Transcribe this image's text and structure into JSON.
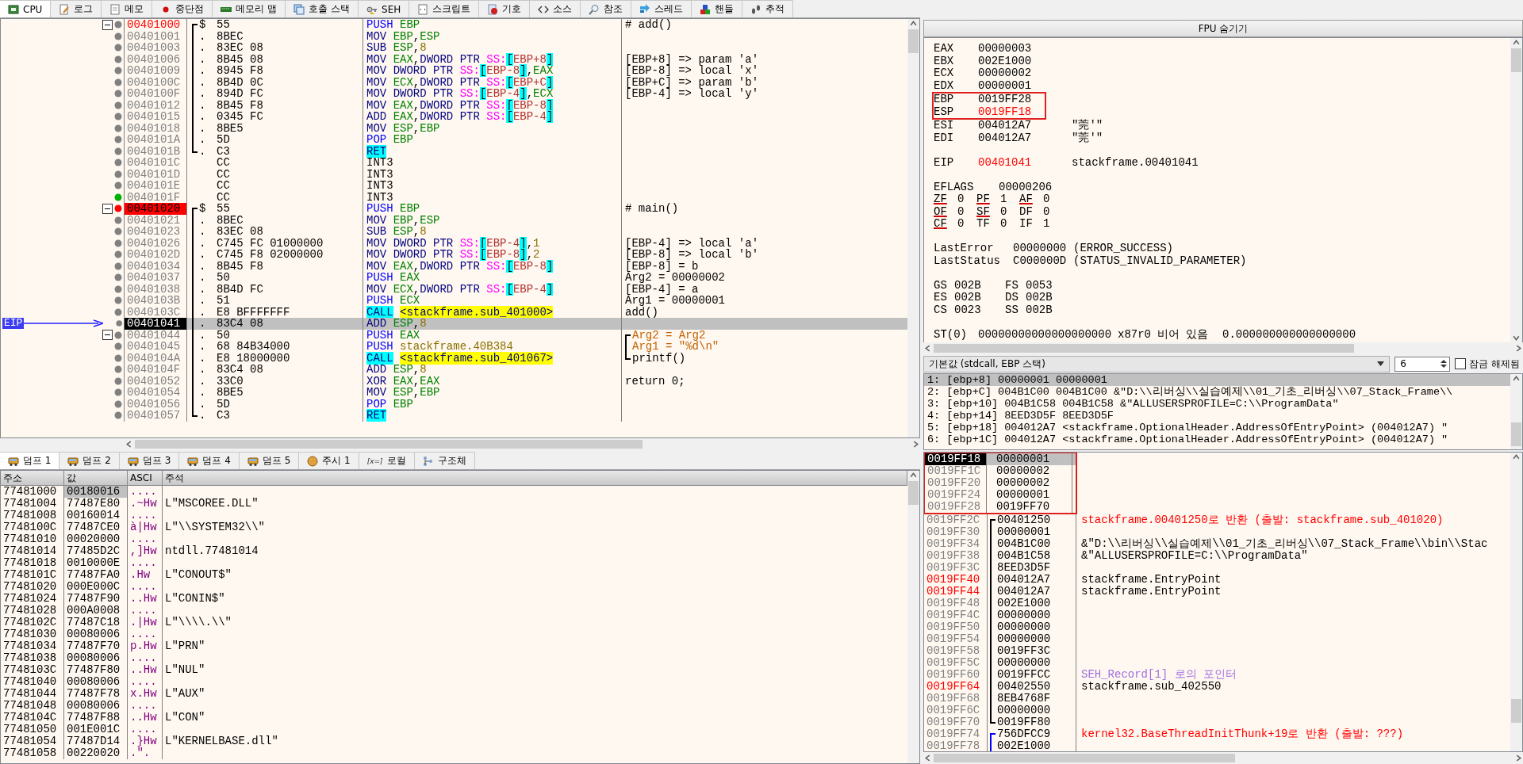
{
  "main_tabs": [
    {
      "label": "CPU",
      "selected": true
    },
    {
      "label": "로그",
      "selected": false
    },
    {
      "label": "메모",
      "selected": false
    },
    {
      "label": "중단점",
      "selected": false
    },
    {
      "label": "메모리 맵",
      "selected": false
    },
    {
      "label": "호출 스택",
      "selected": false
    },
    {
      "label": "SEH",
      "selected": false
    },
    {
      "label": "스크립트",
      "selected": false
    },
    {
      "label": "기호",
      "selected": false
    },
    {
      "label": "소스",
      "selected": false
    },
    {
      "label": "참조",
      "selected": false
    },
    {
      "label": "스레드",
      "selected": false
    },
    {
      "label": "핸들",
      "selected": false
    },
    {
      "label": "추적",
      "selected": false
    }
  ],
  "disassembly": {
    "eip_label": "EIP",
    "rows": [
      {
        "address": "00401000",
        "kind": "function",
        "color": "#808080",
        "collapse": true,
        "bracket": {
          "kind": "start"
        },
        "marker": "$",
        "bytes": "55",
        "mnemonic": {
          "text": "PUSH",
          "kind": "stack"
        },
        "ops": [
          {
            "text": "EBP",
            "kind": "reg"
          }
        ],
        "comment": {
          "text": "# add()",
          "kind": "plain"
        },
        "selected": false
      },
      {
        "address": "00401001",
        "kind": "plain",
        "color": "#808080",
        "collapse": false,
        "bracket": {
          "kind": "mid"
        },
        "marker": ".",
        "bytes": "8BEC",
        "mnemonic": {
          "text": "MOV",
          "kind": "op"
        },
        "ops": [
          {
            "text": "EBP",
            "kind": "reg"
          },
          {
            "text": ",",
            "kind": "sep"
          },
          {
            "text": "ESP",
            "kind": "reg"
          }
        ],
        "selected": false
      },
      {
        "address": "00401003",
        "kind": "plain",
        "color": "#808080",
        "collapse": false,
        "bracket": {
          "kind": "mid"
        },
        "marker": ".",
        "bytes": "83EC 08",
        "mnemonic": {
          "text": "SUB",
          "kind": "op"
        },
        "ops": [
          {
            "text": "ESP",
            "kind": "reg"
          },
          {
            "text": ",",
            "kind": "sep"
          },
          {
            "text": "8",
            "kind": "num"
          }
        ],
        "selected": false
      },
      {
        "address": "00401006",
        "kind": "plain",
        "color": "#808080",
        "collapse": false,
        "bracket": {
          "kind": "mid"
        },
        "marker": ".",
        "bytes": "8B45 08",
        "mnemonic": {
          "text": "MOV",
          "kind": "op"
        },
        "ops": [
          {
            "text": "EAX",
            "kind": "reg"
          },
          {
            "text": ",",
            "kind": "sep"
          },
          {
            "text": "DWORD PTR ",
            "kind": "size"
          },
          {
            "text": "SS:",
            "kind": "seg"
          },
          {
            "text": "[",
            "kind": "brk"
          },
          {
            "text": "EBP+8",
            "kind": "mem"
          },
          {
            "text": "]",
            "kind": "brk"
          }
        ],
        "comment": {
          "text": "[EBP+8] => param 'a'",
          "kind": "plain"
        },
        "selected": false
      },
      {
        "address": "00401009",
        "kind": "plain",
        "color": "#808080",
        "collapse": false,
        "bracket": {
          "kind": "mid"
        },
        "marker": ".",
        "bytes": "8945 F8",
        "mnemonic": {
          "text": "MOV",
          "kind": "op"
        },
        "ops": [
          {
            "text": "DWORD PTR ",
            "kind": "size"
          },
          {
            "text": "SS:",
            "kind": "seg"
          },
          {
            "text": "[",
            "kind": "brk"
          },
          {
            "text": "EBP-8",
            "kind": "mem"
          },
          {
            "text": "]",
            "kind": "brk"
          },
          {
            "text": ",",
            "kind": "sep"
          },
          {
            "text": "EAX",
            "kind": "reg"
          }
        ],
        "comment": {
          "text": "[EBP-8] => local 'x'",
          "kind": "plain"
        },
        "selected": false
      },
      {
        "address": "0040100C",
        "kind": "plain",
        "color": "#808080",
        "collapse": false,
        "bracket": {
          "kind": "mid"
        },
        "marker": ".",
        "bytes": "8B4D 0C",
        "mnemonic": {
          "text": "MOV",
          "kind": "op"
        },
        "ops": [
          {
            "text": "ECX",
            "kind": "reg"
          },
          {
            "text": ",",
            "kind": "sep"
          },
          {
            "text": "DWORD PTR ",
            "kind": "size"
          },
          {
            "text": "SS:",
            "kind": "seg"
          },
          {
            "text": "[",
            "kind": "brk"
          },
          {
            "text": "EBP+C",
            "kind": "mem"
          },
          {
            "text": "]",
            "kind": "brk"
          }
        ],
        "comment": {
          "text": "[EBP+C] => param 'b'",
          "kind": "plain"
        },
        "selected": false
      },
      {
        "address": "0040100F",
        "kind": "plain",
        "color": "#808080",
        "collapse": false,
        "bracket": {
          "kind": "mid"
        },
        "marker": ".",
        "bytes": "894D FC",
        "mnemonic": {
          "text": "MOV",
          "kind": "op"
        },
        "ops": [
          {
            "text": "DWORD PTR ",
            "kind": "size"
          },
          {
            "text": "SS:",
            "kind": "seg"
          },
          {
            "text": "[",
            "kind": "brk"
          },
          {
            "text": "EBP-4",
            "kind": "mem"
          },
          {
            "text": "]",
            "kind": "brk"
          },
          {
            "text": ",",
            "kind": "sep"
          },
          {
            "text": "ECX",
            "kind": "reg"
          }
        ],
        "comment": {
          "text": "[EBP-4] => local 'y'",
          "kind": "plain"
        },
        "selected": false
      },
      {
        "address": "00401012",
        "kind": "plain",
        "color": "#808080",
        "collapse": false,
        "bracket": {
          "kind": "mid"
        },
        "marker": ".",
        "bytes": "8B45 F8",
        "mnemonic": {
          "text": "MOV",
          "kind": "op"
        },
        "ops": [
          {
            "text": "EAX",
            "kind": "reg"
          },
          {
            "text": ",",
            "kind": "sep"
          },
          {
            "text": "DWORD PTR ",
            "kind": "size"
          },
          {
            "text": "SS:",
            "kind": "seg"
          },
          {
            "text": "[",
            "kind": "brk"
          },
          {
            "text": "EBP-8",
            "kind": "mem"
          },
          {
            "text": "]",
            "kind": "brk"
          }
        ],
        "selected": false
      },
      {
        "address": "00401015",
        "kind": "plain",
        "color": "#808080",
        "collapse": false,
        "bracket": {
          "kind": "mid"
        },
        "marker": ".",
        "bytes": "0345 FC",
        "mnemonic": {
          "text": "ADD",
          "kind": "op"
        },
        "ops": [
          {
            "text": "EAX",
            "kind": "reg"
          },
          {
            "text": ",",
            "kind": "sep"
          },
          {
            "text": "DWORD PTR ",
            "kind": "size"
          },
          {
            "text": "SS:",
            "kind": "seg"
          },
          {
            "text": "[",
            "kind": "brk"
          },
          {
            "text": "EBP-4",
            "kind": "mem"
          },
          {
            "text": "]",
            "kind": "brk"
          }
        ],
        "selected": false
      },
      {
        "address": "00401018",
        "kind": "plain",
        "color": "#808080",
        "collapse": false,
        "bracket": {
          "kind": "mid"
        },
        "marker": ".",
        "bytes": "8BE5",
        "mnemonic": {
          "text": "MOV",
          "kind": "op"
        },
        "ops": [
          {
            "text": "ESP",
            "kind": "reg"
          },
          {
            "text": ",",
            "kind": "sep"
          },
          {
            "text": "EBP",
            "kind": "reg"
          }
        ],
        "selected": false
      },
      {
        "address": "0040101A",
        "kind": "plain",
        "color": "#808080",
        "collapse": false,
        "bracket": {
          "kind": "mid"
        },
        "marker": ".",
        "bytes": "5D",
        "mnemonic": {
          "text": "POP",
          "kind": "stack"
        },
        "ops": [
          {
            "text": "EBP",
            "kind": "reg"
          }
        ],
        "selected": false
      },
      {
        "address": "0040101B",
        "kind": "plain",
        "color": "#808080",
        "collapse": false,
        "bracket": {
          "kind": "end"
        },
        "marker": ".",
        "bytes": "C3",
        "mnemonic": {
          "text": "RET",
          "kind": "branch"
        },
        "ops": [],
        "selected": false
      },
      {
        "address": "0040101C",
        "kind": "plain",
        "color": "#808080",
        "collapse": false,
        "bracket": {
          "kind": "none"
        },
        "bytes": "CC",
        "mnemonic": {
          "text": "INT3",
          "kind": "int"
        },
        "ops": [],
        "selected": false
      },
      {
        "address": "0040101D",
        "kind": "plain",
        "color": "#808080",
        "collapse": false,
        "bracket": {
          "kind": "none"
        },
        "bytes": "CC",
        "mnemonic": {
          "text": "INT3",
          "kind": "int"
        },
        "ops": [],
        "selected": false
      },
      {
        "address": "0040101E",
        "kind": "plain",
        "color": "#808080",
        "collapse": false,
        "bracket": {
          "kind": "none"
        },
        "bytes": "CC",
        "mnemonic": {
          "text": "INT3",
          "kind": "int"
        },
        "ops": [],
        "selected": false
      },
      {
        "address": "0040101F",
        "kind": "plain",
        "color": "#00b000",
        "collapse": false,
        "bracket": {
          "kind": "none"
        },
        "bytes": "CC",
        "mnemonic": {
          "text": "INT3",
          "kind": "int"
        },
        "ops": [],
        "selected": false
      },
      {
        "address": "00401020",
        "kind": "breakpoint",
        "color": "#ff0000",
        "collapse": true,
        "bracket": {
          "kind": "start"
        },
        "marker": "$",
        "bytes": "55",
        "mnemonic": {
          "text": "PUSH",
          "kind": "stack"
        },
        "ops": [
          {
            "text": "EBP",
            "kind": "reg"
          }
        ],
        "comment": {
          "text": "# main()",
          "kind": "plain"
        },
        "selected": false
      },
      {
        "address": "00401021",
        "kind": "plain",
        "color": "#808080",
        "collapse": false,
        "bracket": {
          "kind": "mid"
        },
        "marker": ".",
        "bytes": "8BEC",
        "mnemonic": {
          "text": "MOV",
          "kind": "op"
        },
        "ops": [
          {
            "text": "EBP",
            "kind": "reg"
          },
          {
            "text": ",",
            "kind": "sep"
          },
          {
            "text": "ESP",
            "kind": "reg"
          }
        ],
        "selected": false
      },
      {
        "address": "00401023",
        "kind": "plain",
        "color": "#808080",
        "collapse": false,
        "bracket": {
          "kind": "mid"
        },
        "marker": ".",
        "bytes": "83EC 08",
        "mnemonic": {
          "text": "SUB",
          "kind": "op"
        },
        "ops": [
          {
            "text": "ESP",
            "kind": "reg"
          },
          {
            "text": ",",
            "kind": "sep"
          },
          {
            "text": "8",
            "kind": "num"
          }
        ],
        "selected": false
      },
      {
        "address": "00401026",
        "kind": "plain",
        "color": "#808080",
        "collapse": false,
        "bracket": {
          "kind": "mid"
        },
        "marker": ".",
        "bytes": "C745 FC 01000000",
        "mnemonic": {
          "text": "MOV",
          "kind": "op"
        },
        "ops": [
          {
            "text": "DWORD PTR ",
            "kind": "size"
          },
          {
            "text": "SS:",
            "kind": "seg"
          },
          {
            "text": "[",
            "kind": "brk"
          },
          {
            "text": "EBP-4",
            "kind": "mem"
          },
          {
            "text": "]",
            "kind": "brk"
          },
          {
            "text": ",",
            "kind": "sep"
          },
          {
            "text": "1",
            "kind": "num"
          }
        ],
        "comment": {
          "text": "[EBP-4] => local 'a'",
          "kind": "plain"
        },
        "selected": false
      },
      {
        "address": "0040102D",
        "kind": "plain",
        "color": "#808080",
        "collapse": false,
        "bracket": {
          "kind": "mid"
        },
        "marker": ".",
        "bytes": "C745 F8 02000000",
        "mnemonic": {
          "text": "MOV",
          "kind": "op"
        },
        "ops": [
          {
            "text": "DWORD PTR ",
            "kind": "size"
          },
          {
            "text": "SS:",
            "kind": "seg"
          },
          {
            "text": "[",
            "kind": "brk"
          },
          {
            "text": "EBP-8",
            "kind": "mem"
          },
          {
            "text": "]",
            "kind": "brk"
          },
          {
            "text": ",",
            "kind": "sep"
          },
          {
            "text": "2",
            "kind": "num"
          }
        ],
        "comment": {
          "text": "[EBP-8] => local 'b'",
          "kind": "plain"
        },
        "selected": false
      },
      {
        "address": "00401034",
        "kind": "plain",
        "color": "#808080",
        "collapse": false,
        "bracket": {
          "kind": "mid"
        },
        "marker": ".",
        "bytes": "8B45 F8",
        "mnemonic": {
          "text": "MOV",
          "kind": "op"
        },
        "ops": [
          {
            "text": "EAX",
            "kind": "reg"
          },
          {
            "text": ",",
            "kind": "sep"
          },
          {
            "text": "DWORD PTR ",
            "kind": "size"
          },
          {
            "text": "SS:",
            "kind": "seg"
          },
          {
            "text": "[",
            "kind": "brk"
          },
          {
            "text": "EBP-8",
            "kind": "mem"
          },
          {
            "text": "]",
            "kind": "brk"
          }
        ],
        "comment": {
          "text": "[EBP-8] = b",
          "kind": "plain"
        },
        "selected": false
      },
      {
        "address": "00401037",
        "kind": "plain",
        "color": "#808080",
        "collapse": false,
        "bracket": {
          "kind": "mid"
        },
        "marker": ".",
        "bytes": "50",
        "mnemonic": {
          "text": "PUSH",
          "kind": "stack"
        },
        "ops": [
          {
            "text": "EAX",
            "kind": "reg"
          }
        ],
        "comment": {
          "text": "Arg2 = 00000002",
          "kind": "plain"
        },
        "selected": false
      },
      {
        "address": "00401038",
        "kind": "plain",
        "color": "#808080",
        "collapse": false,
        "bracket": {
          "kind": "mid"
        },
        "marker": ".",
        "bytes": "8B4D FC",
        "mnemonic": {
          "text": "MOV",
          "kind": "op"
        },
        "ops": [
          {
            "text": "ECX",
            "kind": "reg"
          },
          {
            "text": ",",
            "kind": "sep"
          },
          {
            "text": "DWORD PTR ",
            "kind": "size"
          },
          {
            "text": "SS:",
            "kind": "seg"
          },
          {
            "text": "[",
            "kind": "brk"
          },
          {
            "text": "EBP-4",
            "kind": "mem"
          },
          {
            "text": "]",
            "kind": "brk"
          }
        ],
        "comment": {
          "text": "[EBP-4] = a",
          "kind": "plain"
        },
        "selected": false
      },
      {
        "address": "0040103B",
        "kind": "plain",
        "color": "#808080",
        "collapse": false,
        "bracket": {
          "kind": "mid"
        },
        "marker": ".",
        "bytes": "51",
        "mnemonic": {
          "text": "PUSH",
          "kind": "stack"
        },
        "ops": [
          {
            "text": "ECX",
            "kind": "reg"
          }
        ],
        "comment": {
          "text": "Arg1 = 00000001",
          "kind": "plain"
        },
        "selected": false
      },
      {
        "address": "0040103C",
        "kind": "plain",
        "color": "#808080",
        "collapse": false,
        "bracket": {
          "kind": "mid"
        },
        "marker": ".",
        "bytes": "E8 BFFFFFFF",
        "mnemonic": {
          "text": "CALL",
          "kind": "branch"
        },
        "ops": [
          {
            "text": "<stackframe.sub_401000>",
            "kind": "label"
          }
        ],
        "comment": {
          "text": "add()",
          "kind": "plain"
        },
        "selected": false
      },
      {
        "address": "00401041",
        "kind": "plain",
        "color": "#808080",
        "collapse": false,
        "bracket": {
          "kind": "mid"
        },
        "marker": ".",
        "bytes": "83C4 08",
        "mnemonic": {
          "text": "ADD",
          "kind": "op"
        },
        "ops": [
          {
            "text": "ESP",
            "kind": "reg"
          },
          {
            "text": ",",
            "kind": "sep"
          },
          {
            "text": "8",
            "kind": "num"
          }
        ],
        "selected": true
      },
      {
        "address": "00401044",
        "kind": "plain",
        "color": "#808080",
        "collapse": true,
        "bracket": {
          "kind": "mid"
        },
        "marker": ".",
        "bytes": "50",
        "mnemonic": {
          "text": "PUSH",
          "kind": "stack"
        },
        "ops": [
          {
            "text": "EAX",
            "kind": "reg"
          }
        ],
        "comment": {
          "text": "Arg2 = Arg2",
          "kind": "arg",
          "bracket": {
            "kind": "start"
          }
        },
        "selected": false
      },
      {
        "address": "00401045",
        "kind": "plain",
        "color": "#808080",
        "collapse": false,
        "bracket": {
          "kind": "mid"
        },
        "marker": ".",
        "bytes": "68 84B34000",
        "mnemonic": {
          "text": "PUSH",
          "kind": "stack"
        },
        "ops": [
          {
            "text": "stackframe.40B384",
            "kind": "num"
          }
        ],
        "comment": {
          "text": "Arg1 = \"%d\\n\"",
          "kind": "arg",
          "bracket": {
            "kind": "mid"
          }
        },
        "selected": false
      },
      {
        "address": "0040104A",
        "kind": "plain",
        "color": "#808080",
        "collapse": false,
        "bracket": {
          "kind": "mid"
        },
        "marker": ".",
        "bytes": "E8 18000000",
        "mnemonic": {
          "text": "CALL",
          "kind": "branch"
        },
        "ops": [
          {
            "text": "<stackframe.sub_401067>",
            "kind": "label"
          }
        ],
        "comment": {
          "text": "printf()",
          "kind": "plain",
          "bracket": {
            "kind": "end"
          }
        },
        "selected": false
      },
      {
        "address": "0040104F",
        "kind": "plain",
        "color": "#808080",
        "collapse": false,
        "bracket": {
          "kind": "mid"
        },
        "marker": ".",
        "bytes": "83C4 08",
        "mnemonic": {
          "text": "ADD",
          "kind": "op"
        },
        "ops": [
          {
            "text": "ESP",
            "kind": "reg"
          },
          {
            "text": ",",
            "kind": "sep"
          },
          {
            "text": "8",
            "kind": "num"
          }
        ],
        "selected": false
      },
      {
        "address": "00401052",
        "kind": "plain",
        "color": "#808080",
        "collapse": false,
        "bracket": {
          "kind": "mid"
        },
        "marker": ".",
        "bytes": "33C0",
        "mnemonic": {
          "text": "XOR",
          "kind": "op"
        },
        "ops": [
          {
            "text": "EAX",
            "kind": "reg"
          },
          {
            "text": ",",
            "kind": "sep"
          },
          {
            "text": "EAX",
            "kind": "reg"
          }
        ],
        "comment": {
          "text": "return 0;",
          "kind": "plain"
        },
        "selected": false
      },
      {
        "address": "00401054",
        "kind": "plain",
        "color": "#808080",
        "collapse": false,
        "bracket": {
          "kind": "mid"
        },
        "marker": ".",
        "bytes": "8BE5",
        "mnemonic": {
          "text": "MOV",
          "kind": "op"
        },
        "ops": [
          {
            "text": "ESP",
            "kind": "reg"
          },
          {
            "text": ",",
            "kind": "sep"
          },
          {
            "text": "EBP",
            "kind": "reg"
          }
        ],
        "selected": false
      },
      {
        "address": "00401056",
        "kind": "plain",
        "color": "#808080",
        "collapse": false,
        "bracket": {
          "kind": "mid"
        },
        "marker": ".",
        "bytes": "5D",
        "mnemonic": {
          "text": "POP",
          "kind": "stack"
        },
        "ops": [
          {
            "text": "EBP",
            "kind": "reg"
          }
        ],
        "selected": false
      },
      {
        "address": "00401057",
        "kind": "plain",
        "color": "#808080",
        "collapse": false,
        "bracket": {
          "kind": "end"
        },
        "marker": ".",
        "bytes": "C3",
        "mnemonic": {
          "text": "RET",
          "kind": "branch"
        },
        "ops": [],
        "selected": false
      }
    ]
  },
  "registers": {
    "toggle_button": "FPU 숨기기",
    "general": [
      {
        "name": "EAX",
        "value": "00000003",
        "changed": false,
        "boxed": false
      },
      {
        "name": "EBX",
        "value": "002E1000",
        "changed": false,
        "boxed": false
      },
      {
        "name": "ECX",
        "value": "00000002",
        "changed": false,
        "boxed": false
      },
      {
        "name": "EDX",
        "value": "00000001",
        "changed": false,
        "boxed": false
      },
      {
        "name": "EBP",
        "value": "0019FF28",
        "changed": false,
        "boxed": true
      },
      {
        "name": "ESP",
        "value": "0019FF18",
        "changed": true,
        "boxed": true
      },
      {
        "name": "ESI",
        "value": "004012A7",
        "note": "\"莞'\"",
        "changed": false,
        "boxed": false
      },
      {
        "name": "EDI",
        "value": "004012A7",
        "note": "\"莞'\"",
        "changed": false,
        "boxed": false
      }
    ],
    "eip": {
      "name": "EIP",
      "value": "00401041",
      "note": "stackframe.00401041",
      "changed": true
    },
    "eflags": {
      "name": "EFLAGS",
      "value": "00000206"
    },
    "flags": [
      [
        {
          "name": "ZF",
          "value": "0",
          "underlined": true
        },
        {
          "name": "PF",
          "value": "1",
          "underlined": true
        },
        {
          "name": "AF",
          "value": "0",
          "underlined": true
        }
      ],
      [
        {
          "name": "OF",
          "value": "0",
          "underlined": true
        },
        {
          "name": "SF",
          "value": "0",
          "underlined": true
        },
        {
          "name": "DF",
          "value": "0",
          "underlined": false
        }
      ],
      [
        {
          "name": "CF",
          "value": "0",
          "underlined": true
        },
        {
          "name": "TF",
          "value": "0",
          "underlined": false
        },
        {
          "name": "IF",
          "value": "1",
          "underlined": false
        }
      ]
    ],
    "status": [
      {
        "name": "LastError",
        "value": "00000000",
        "note": "(ERROR_SUCCESS)"
      },
      {
        "name": "LastStatus",
        "value": "C000000D",
        "note": "(STATUS_INVALID_PARAMETER)"
      }
    ],
    "segments": [
      [
        {
          "name": "GS",
          "value": "002B"
        },
        {
          "name": "FS",
          "value": "0053"
        }
      ],
      [
        {
          "name": "ES",
          "value": "002B"
        },
        {
          "name": "DS",
          "value": "002B"
        }
      ],
      [
        {
          "name": "CS",
          "value": "0023"
        },
        {
          "name": "SS",
          "value": "002B"
        }
      ]
    ],
    "fpu": {
      "name": "ST(0)",
      "value": "00000000000000000000",
      "tag": "x87r0",
      "state": "비어 있음",
      "float": "0.000000000000000000"
    }
  },
  "call_args": {
    "convention": "기본값 (stdcall, EBP 스택)",
    "count": "6",
    "lock_label": "잠금 해제됨",
    "checked": false,
    "rows": [
      {
        "text": "1: [ebp+8] 00000001 00000001",
        "selected": true
      },
      {
        "text": "2: [ebp+C] 004B1C00 004B1C00 &\"D:\\\\리버싱\\\\실습예제\\\\01_기초_리버싱\\\\07_Stack_Frame\\\\",
        "selected": false
      },
      {
        "text": "3: [ebp+10] 004B1C58 004B1C58 &\"ALLUSERSPROFILE=C:\\\\ProgramData\"",
        "selected": false
      },
      {
        "text": "4: [ebp+14] 8EED3D5F 8EED3D5F",
        "selected": false
      },
      {
        "text": "5: [ebp+18] 004012A7 <stackframe.OptionalHeader.AddressOfEntryPoint> (004012A7) \"",
        "selected": false
      },
      {
        "text": "6: [ebp+1C] 004012A7 <stackframe.OptionalHeader.AddressOfEntryPoint> (004012A7) \"",
        "selected": false
      }
    ]
  },
  "dump_tabs": [
    {
      "label": "덤프 1",
      "selected": true
    },
    {
      "label": "덤프 2",
      "selected": false
    },
    {
      "label": "덤프 3",
      "selected": false
    },
    {
      "label": "덤프 4",
      "selected": false
    },
    {
      "label": "덤프 5",
      "selected": false
    },
    {
      "label": "주시 1",
      "selected": false
    },
    {
      "label": "로컬",
      "badge": "[x=]",
      "selected": false
    },
    {
      "label": "구조체",
      "selected": false
    }
  ],
  "dump": {
    "columns": [
      "주소",
      "값",
      "ASCI",
      "주석"
    ],
    "rows": [
      {
        "address": "77481000",
        "value": "00180016",
        "ascii": "....",
        "selected": true
      },
      {
        "address": "77481004",
        "value": "77487E80",
        "ascii": ".~Hw",
        "comment": "L\"MSCOREE.DLL\"",
        "selected": false
      },
      {
        "address": "77481008",
        "value": "00160014",
        "ascii": "....",
        "selected": false
      },
      {
        "address": "7748100C",
        "value": "77487CE0",
        "ascii": "à|Hw",
        "comment": "L\"\\\\SYSTEM32\\\\\"",
        "selected": false
      },
      {
        "address": "77481010",
        "value": "00020000",
        "ascii": "....",
        "selected": false
      },
      {
        "address": "77481014",
        "value": "77485D2C",
        "ascii": ",]Hw",
        "comment": "ntdll.77481014",
        "selected": false
      },
      {
        "address": "77481018",
        "value": "0010000E",
        "ascii": "....",
        "selected": false
      },
      {
        "address": "7748101C",
        "value": "77487FA0",
        "ascii": ".Hw",
        "comment": "L\"CONOUT$\"",
        "selected": false
      },
      {
        "address": "77481020",
        "value": "000E000C",
        "ascii": "....",
        "selected": false
      },
      {
        "address": "77481024",
        "value": "77487F90",
        "ascii": "..Hw",
        "comment": "L\"CONIN$\"",
        "selected": false
      },
      {
        "address": "77481028",
        "value": "000A0008",
        "ascii": "....",
        "selected": false
      },
      {
        "address": "7748102C",
        "value": "77487C18",
        "ascii": ".|Hw",
        "comment": "L\"\\\\\\\\.\\\\\"",
        "selected": false
      },
      {
        "address": "77481030",
        "value": "00080006",
        "ascii": "....",
        "selected": false
      },
      {
        "address": "77481034",
        "value": "77487F70",
        "ascii": "p.Hw",
        "comment": "L\"PRN\"",
        "selected": false
      },
      {
        "address": "77481038",
        "value": "00080006",
        "ascii": "....",
        "selected": false
      },
      {
        "address": "7748103C",
        "value": "77487F80",
        "ascii": "..Hw",
        "comment": "L\"NUL\"",
        "selected": false
      },
      {
        "address": "77481040",
        "value": "00080006",
        "ascii": "....",
        "selected": false
      },
      {
        "address": "77481044",
        "value": "77487F78",
        "ascii": "x.Hw",
        "comment": "L\"AUX\"",
        "selected": false
      },
      {
        "address": "77481048",
        "value": "00080006",
        "ascii": "....",
        "selected": false
      },
      {
        "address": "7748104C",
        "value": "77487F88",
        "ascii": "..Hw",
        "comment": "L\"CON\"",
        "selected": false
      },
      {
        "address": "77481050",
        "value": "001E001C",
        "ascii": "....",
        "selected": false
      },
      {
        "address": "77481054",
        "value": "77487D14",
        "ascii": ".}Hw",
        "comment": "L\"KERNELBASE.dll\"",
        "selected": false
      },
      {
        "address": "77481058",
        "value": "00220020",
        "ascii": ".\".",
        "selected": false
      }
    ]
  },
  "stack": {
    "rows": [
      {
        "address": "0019FF18",
        "value": "00000001",
        "kind": "plain",
        "bracket": {
          "kind": "none"
        },
        "boxed": true,
        "selected": true
      },
      {
        "address": "0019FF1C",
        "value": "00000002",
        "kind": "plain",
        "bracket": {
          "kind": "none"
        },
        "boxed": true,
        "selected": false
      },
      {
        "address": "0019FF20",
        "value": "00000002",
        "kind": "plain",
        "bracket": {
          "kind": "none"
        },
        "boxed": true,
        "selected": false
      },
      {
        "address": "0019FF24",
        "value": "00000001",
        "kind": "plain",
        "bracket": {
          "kind": "none"
        },
        "boxed": true,
        "selected": false
      },
      {
        "address": "0019FF28",
        "value": "0019FF70",
        "kind": "plain",
        "bracket": {
          "kind": "none"
        },
        "boxed": true,
        "selected": false
      },
      {
        "address": "0019FF2C",
        "value": "00401250",
        "kind": "plain",
        "bracket": {
          "kind": "start",
          "color": "#000000"
        },
        "boxed": false,
        "comment": {
          "text": "stackframe.00401250로 반환 (출발: stackframe.sub_401020)",
          "kind": "return"
        },
        "selected": false
      },
      {
        "address": "0019FF30",
        "value": "00000001",
        "kind": "plain",
        "bracket": {
          "kind": "mid",
          "color": "#000000"
        },
        "boxed": false,
        "selected": false
      },
      {
        "address": "0019FF34",
        "value": "004B1C00",
        "kind": "plain",
        "bracket": {
          "kind": "mid",
          "color": "#000000"
        },
        "boxed": false,
        "comment": {
          "text": "&\"D:\\\\리버싱\\\\실습예제\\\\01_기초_리버싱\\\\07_Stack_Frame\\\\bin\\\\Stac",
          "kind": "plain"
        },
        "selected": false
      },
      {
        "address": "0019FF38",
        "value": "004B1C58",
        "kind": "plain",
        "bracket": {
          "kind": "mid",
          "color": "#000000"
        },
        "boxed": false,
        "comment": {
          "text": "&\"ALLUSERSPROFILE=C:\\\\ProgramData\"",
          "kind": "plain"
        },
        "selected": false
      },
      {
        "address": "0019FF3C",
        "value": "8EED3D5F",
        "kind": "plain",
        "bracket": {
          "kind": "mid",
          "color": "#000000"
        },
        "boxed": false,
        "selected": false
      },
      {
        "address": "0019FF40",
        "value": "004012A7",
        "kind": "code",
        "bracket": {
          "kind": "mid",
          "color": "#000000"
        },
        "boxed": false,
        "comment": {
          "text": "stackframe.EntryPoint",
          "kind": "plain"
        },
        "selected": false
      },
      {
        "address": "0019FF44",
        "value": "004012A7",
        "kind": "code",
        "bracket": {
          "kind": "mid",
          "color": "#000000"
        },
        "boxed": false,
        "comment": {
          "text": "stackframe.EntryPoint",
          "kind": "plain"
        },
        "selected": false
      },
      {
        "address": "0019FF48",
        "value": "002E1000",
        "kind": "plain",
        "bracket": {
          "kind": "mid",
          "color": "#000000"
        },
        "boxed": false,
        "selected": false
      },
      {
        "address": "0019FF4C",
        "value": "00000000",
        "kind": "plain",
        "bracket": {
          "kind": "mid",
          "color": "#000000"
        },
        "boxed": false,
        "selected": false
      },
      {
        "address": "0019FF50",
        "value": "00000000",
        "kind": "plain",
        "bracket": {
          "kind": "mid",
          "color": "#000000"
        },
        "boxed": false,
        "selected": false
      },
      {
        "address": "0019FF54",
        "value": "00000000",
        "kind": "plain",
        "bracket": {
          "kind": "mid",
          "color": "#000000"
        },
        "boxed": false,
        "selected": false
      },
      {
        "address": "0019FF58",
        "value": "0019FF3C",
        "kind": "plain",
        "bracket": {
          "kind": "mid",
          "color": "#000000"
        },
        "boxed": false,
        "selected": false
      },
      {
        "address": "0019FF5C",
        "value": "00000000",
        "kind": "plain",
        "bracket": {
          "kind": "mid",
          "color": "#000000"
        },
        "boxed": false,
        "selected": false
      },
      {
        "address": "0019FF60",
        "value": "0019FFCC",
        "kind": "plain",
        "bracket": {
          "kind": "mid",
          "color": "#000000"
        },
        "boxed": false,
        "comment": {
          "text": "SEH_Record[1] 로의 포인터",
          "kind": "seh"
        },
        "selected": false
      },
      {
        "address": "0019FF64",
        "value": "00402550",
        "kind": "code",
        "bracket": {
          "kind": "mid",
          "color": "#000000"
        },
        "boxed": false,
        "comment": {
          "text": "stackframe.sub_402550",
          "kind": "plain"
        },
        "selected": false
      },
      {
        "address": "0019FF68",
        "value": "8EB4768F",
        "kind": "plain",
        "bracket": {
          "kind": "mid",
          "color": "#000000"
        },
        "boxed": false,
        "selected": false
      },
      {
        "address": "0019FF6C",
        "value": "00000000",
        "kind": "plain",
        "bracket": {
          "kind": "mid",
          "color": "#000000"
        },
        "boxed": false,
        "selected": false
      },
      {
        "address": "0019FF70",
        "value": "0019FF80",
        "kind": "plain",
        "bracket": {
          "kind": "end",
          "color": "#000000"
        },
        "boxed": false,
        "selected": false
      },
      {
        "address": "0019FF74",
        "value": "756DFCC9",
        "kind": "plain",
        "bracket": {
          "kind": "start",
          "color": "#0000ff"
        },
        "boxed": false,
        "comment": {
          "text": "kernel32.BaseThreadInitThunk+19로 반환 (출발: ???)",
          "kind": "return"
        },
        "selected": false
      },
      {
        "address": "0019FF78",
        "value": "002E1000",
        "kind": "plain",
        "bracket": {
          "kind": "mid",
          "color": "#0000ff"
        },
        "boxed": false,
        "selected": false
      }
    ]
  }
}
